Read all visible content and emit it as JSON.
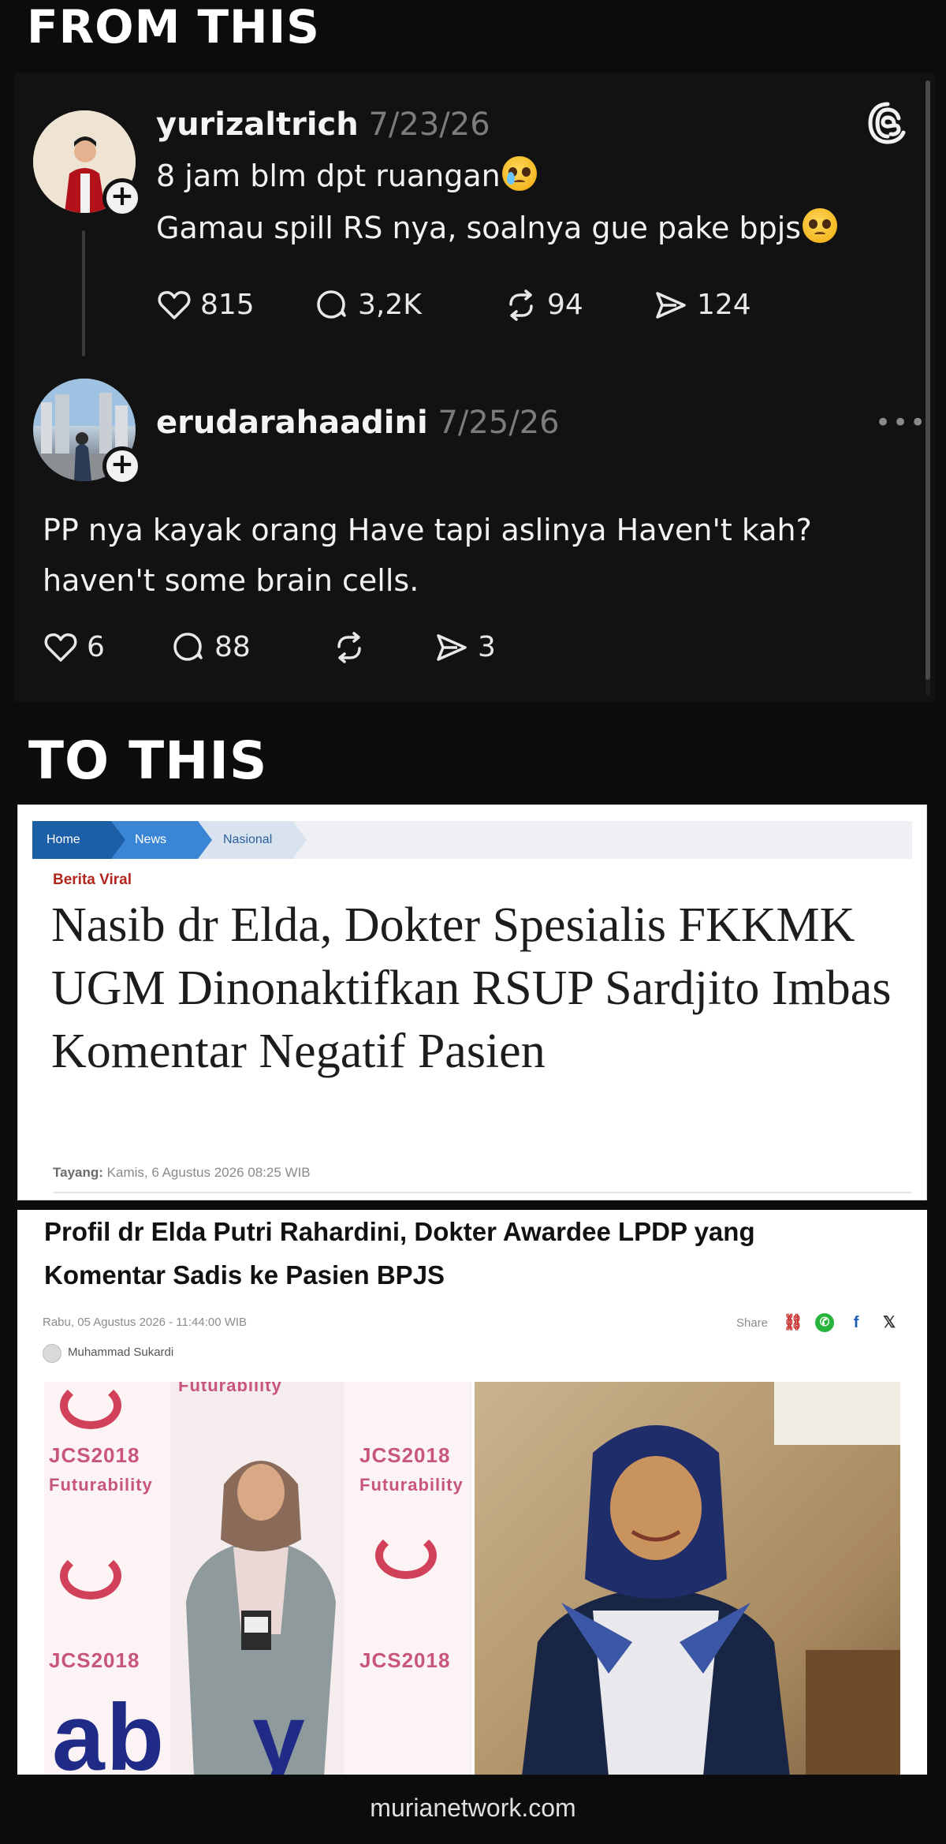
{
  "banners": {
    "from": "FROM THIS",
    "to": "TO THIS"
  },
  "threads": {
    "posts": [
      {
        "username": "yurizaltrich",
        "date": "7/23/26",
        "line1": "8 jam blm dpt ruangan",
        "line2": "Gamau spill RS nya, soalnya gue pake bpjs",
        "emoji1": "crying-face-emoji",
        "emoji2": "pleading-face-emoji",
        "likes": "815",
        "replies": "3,2K",
        "reposts": "94",
        "shares": "124"
      },
      {
        "username": "erudarahaadini",
        "date": "7/25/26",
        "line1": "PP nya kayak orang Have tapi aslinya Haven't kah?",
        "line2": "haven't some brain cells.",
        "likes": "6",
        "replies": "88",
        "reposts": "",
        "shares": "3"
      }
    ],
    "more_icon": "•••"
  },
  "news1": {
    "breadcrumb": [
      "Home",
      "News",
      "Nasional"
    ],
    "category": "Berita Viral",
    "title": "Nasib dr Elda, Dokter Spesialis FKKMK UGM Dinonaktifkan RSUP Sardjito Imbas Komentar Negatif Pasien",
    "date_label": "Tayang:",
    "date_value": "Kamis, 6 Agustus 2026 08:25 WIB"
  },
  "news2": {
    "title": "Profil dr Elda Putri Rahardini, Dokter Awardee LPDP yang Komentar Sadis ke Pasien BPJS",
    "date": "Rabu, 05 Agustus 2026 - 11:44:00 WIB",
    "share_label": "Share",
    "share_icons": {
      "link": "⛓",
      "whatsapp": "✆",
      "facebook": "f",
      "x": "𝕏"
    },
    "author": "Muhammad Sukardi",
    "photo_banner": {
      "top": "Futurability",
      "jcs": "JCS2018",
      "fut": "Futurability",
      "bottom_big": "ab",
      "bottom_y": "y"
    }
  },
  "footer": "murianetwork.com",
  "colors": {
    "threads_bg": "#121212",
    "breadcrumb_home": "#1d5fa6",
    "breadcrumb_news": "#3a86d4",
    "category_red": "#b3261e"
  }
}
